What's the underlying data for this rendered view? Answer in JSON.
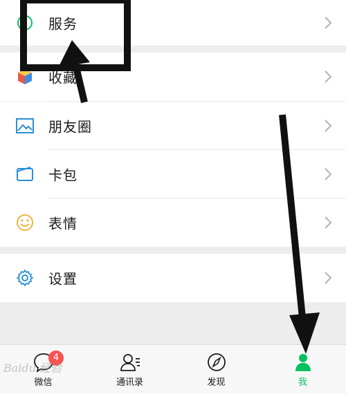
{
  "menu": {
    "service": "服务",
    "favorites": "收藏",
    "moments": "朋友圈",
    "cards": "卡包",
    "stickers": "表情",
    "settings": "设置"
  },
  "tabbar": {
    "chats": "微信",
    "chats_badge": "4",
    "contacts": "通讯录",
    "discover": "发现",
    "me": "我"
  },
  "watermark": "Baidu 经验",
  "colors": {
    "accent": "#07c160",
    "badge": "#fa5151",
    "icon_blue": "#2b8fd6"
  }
}
